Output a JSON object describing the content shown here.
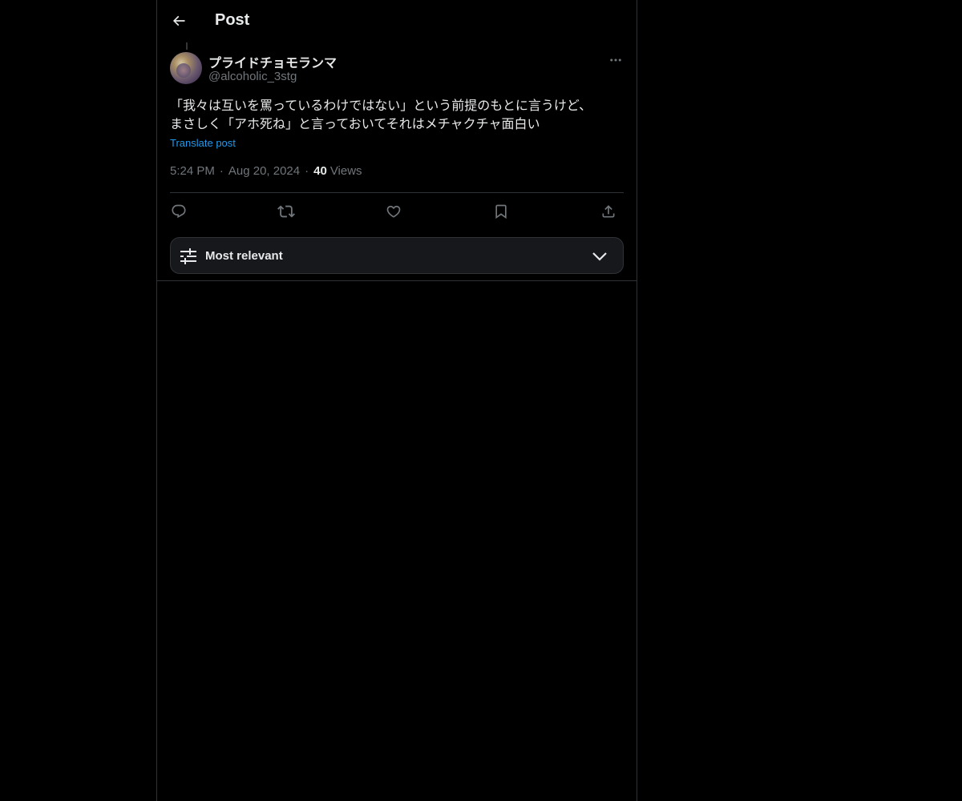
{
  "header": {
    "title": "Post",
    "back_icon": "arrow-left-icon"
  },
  "post": {
    "author": {
      "display_name": "プライドチョモランマ",
      "handle": "@alcoholic_3stg"
    },
    "text_lines": [
      "「我々は互いを罵っているわけではない」という前提のもとに言うけど、",
      "まさしく「アホ死ね」と言っておいてそれはメチャクチャ面白い"
    ],
    "translate_label": "Translate post",
    "time": "5:24 PM",
    "date": "Aug 20, 2024",
    "separator": "·",
    "views_count": "40",
    "views_label": "Views"
  },
  "actions": {
    "reply_icon": "reply-icon",
    "repost_icon": "repost-icon",
    "like_icon": "heart-icon",
    "bookmark_icon": "bookmark-icon",
    "share_icon": "share-icon"
  },
  "sort": {
    "label": "Most relevant",
    "icon": "sliders-icon",
    "chevron": "chevron-down-icon"
  },
  "colors": {
    "background": "#000000",
    "text": "#e7e9ea",
    "secondary_text": "#71767b",
    "link": "#1d9bf0",
    "border": "#2f3336"
  }
}
